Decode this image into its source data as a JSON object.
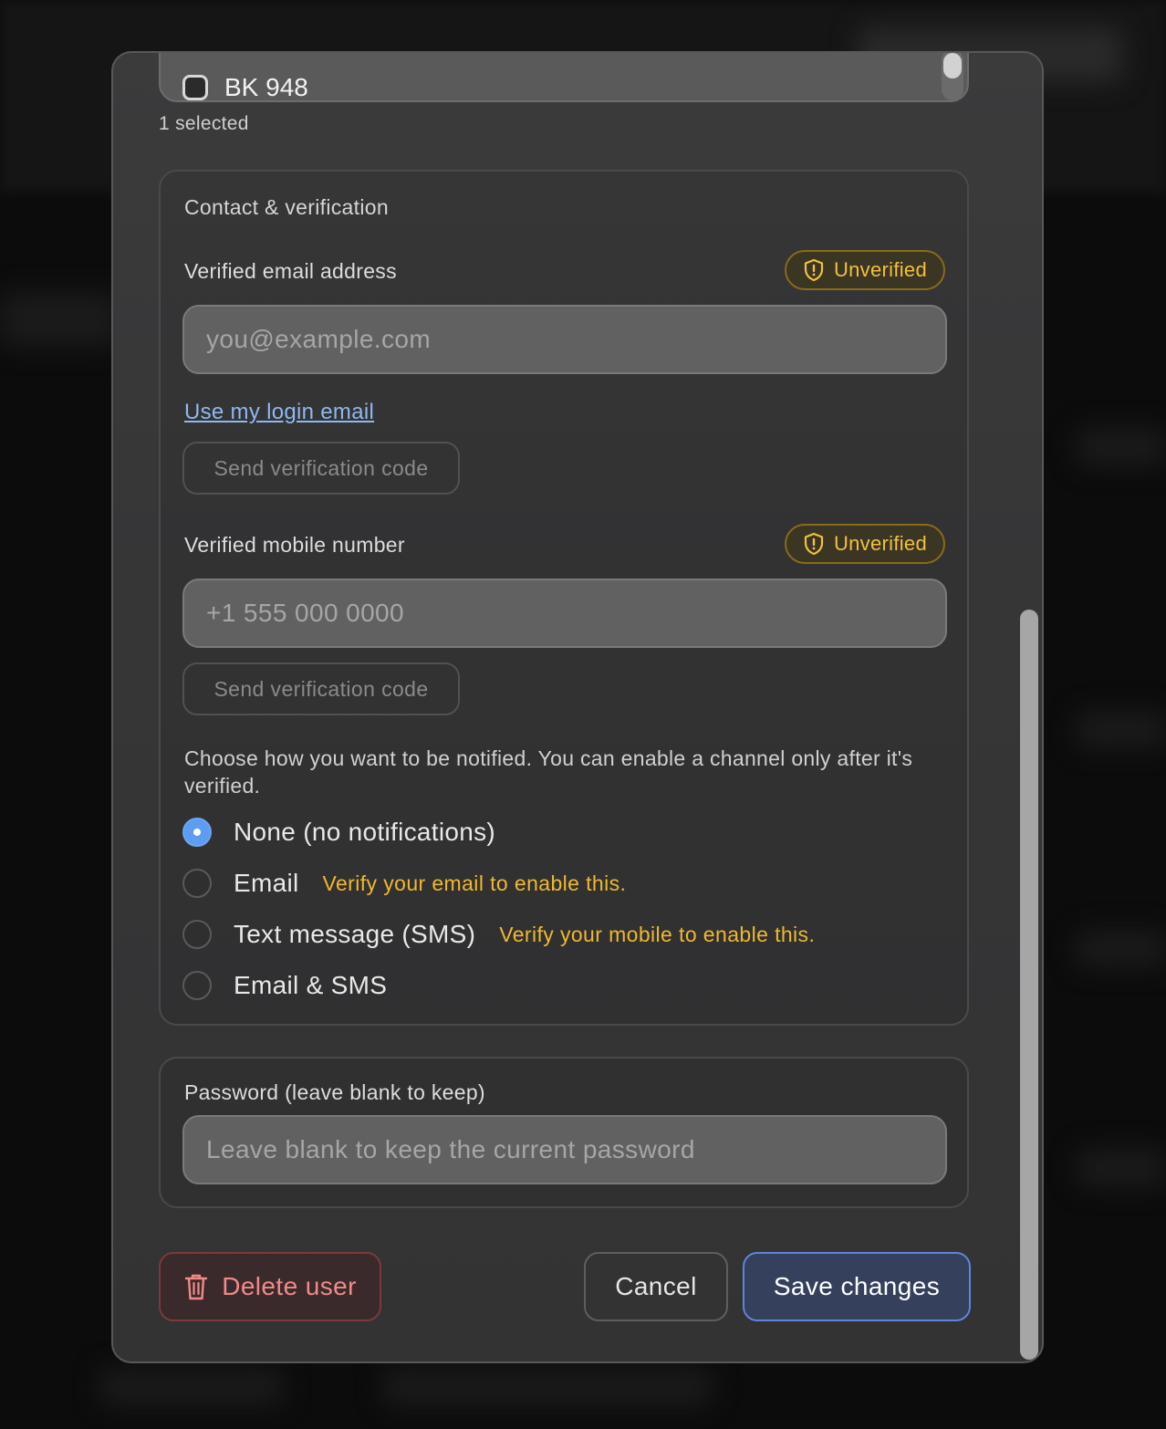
{
  "group_list": {
    "item_label": "BK 948",
    "checked": false
  },
  "selected_count": "1 selected",
  "contact": {
    "section_title": "Contact & verification",
    "email": {
      "label": "Verified email address",
      "badge": "Unverified",
      "placeholder": "you@example.com",
      "link": "Use my login email",
      "send_button": "Send verification code"
    },
    "mobile": {
      "label": "Verified mobile number",
      "badge": "Unverified",
      "placeholder": "+1 555 000 0000",
      "send_button": "Send verification code"
    },
    "help_text": "Choose how you want to be notified. You can enable a channel only after it's verified.",
    "options": [
      {
        "label": "None (no notifications)",
        "hint": "",
        "checked": true
      },
      {
        "label": "Email",
        "hint": "Verify your email to enable this.",
        "checked": false
      },
      {
        "label": "Text message (SMS)",
        "hint": "Verify your mobile to enable this.",
        "checked": false
      },
      {
        "label": "Email & SMS",
        "hint": "",
        "checked": false
      }
    ]
  },
  "password": {
    "label": "Password (leave blank to keep)",
    "placeholder": "Leave blank to keep the current password"
  },
  "footer": {
    "delete_label": "Delete user",
    "cancel_label": "Cancel",
    "save_label": "Save changes"
  },
  "colors": {
    "warning": "#f2c13a",
    "link": "#8fb8f0",
    "primary": "#5d9cf0",
    "danger": "#f08a8a"
  }
}
